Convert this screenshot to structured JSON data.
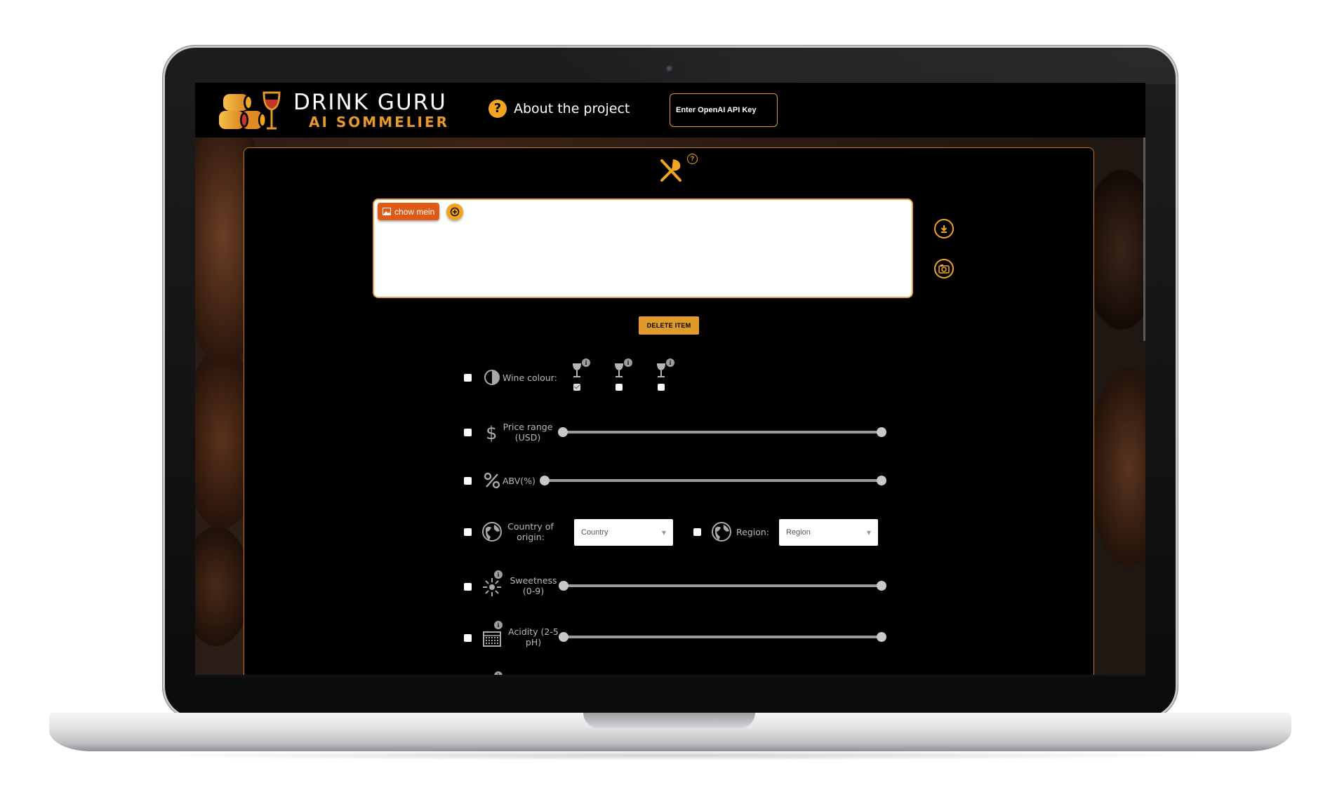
{
  "header": {
    "logo_title": "DRINK GURU",
    "logo_subtitle": "AI SOMMELIER",
    "about_label": "About the project",
    "about_icon": "question-circle-icon",
    "api_key_placeholder": "Enter OpenAI API Key"
  },
  "food": {
    "section_icon": "fork-knife-icon",
    "help_icon": "question-mark",
    "help_glyph": "?",
    "chips": [
      {
        "label": "chow mein",
        "icon": "image-icon"
      }
    ],
    "add_icon": "plus-circle-icon",
    "download_icon": "download-icon",
    "camera_icon": "camera-icon",
    "delete_label": "DELETE ITEM"
  },
  "filters": {
    "wine_colour": {
      "label": "Wine colour:",
      "icon": "drop-icon",
      "options": [
        {
          "icon": "wine-glass-icon",
          "checked": true
        },
        {
          "icon": "wine-glass-icon",
          "checked": false
        },
        {
          "icon": "wine-glass-icon",
          "checked": false
        }
      ]
    },
    "price_range": {
      "label_line1": "Price range",
      "label_line2": "(USD)",
      "icon": "dollar-icon"
    },
    "abv": {
      "label": "ABV(%)",
      "icon": "percent-icon"
    },
    "country": {
      "label_line1": "Country of",
      "label_line2": "origin:",
      "icon": "globe-icon",
      "select_value": "Country"
    },
    "region": {
      "label": "Region:",
      "icon": "globe-icon",
      "select_value": "Region"
    },
    "sweetness": {
      "label_line1": "Sweetness",
      "label_line2": "(0-9)",
      "icon": "sparkle-icon"
    },
    "acidity": {
      "label_line1": "Acidity (2-5",
      "label_line2": "pH)",
      "icon": "acidity-icon"
    },
    "info_glyph": "i"
  },
  "colors": {
    "accent": "#f0a41f",
    "chip": "#dd5a17",
    "border": "#c4762d",
    "logo_subtitle": "#e39a2b"
  }
}
